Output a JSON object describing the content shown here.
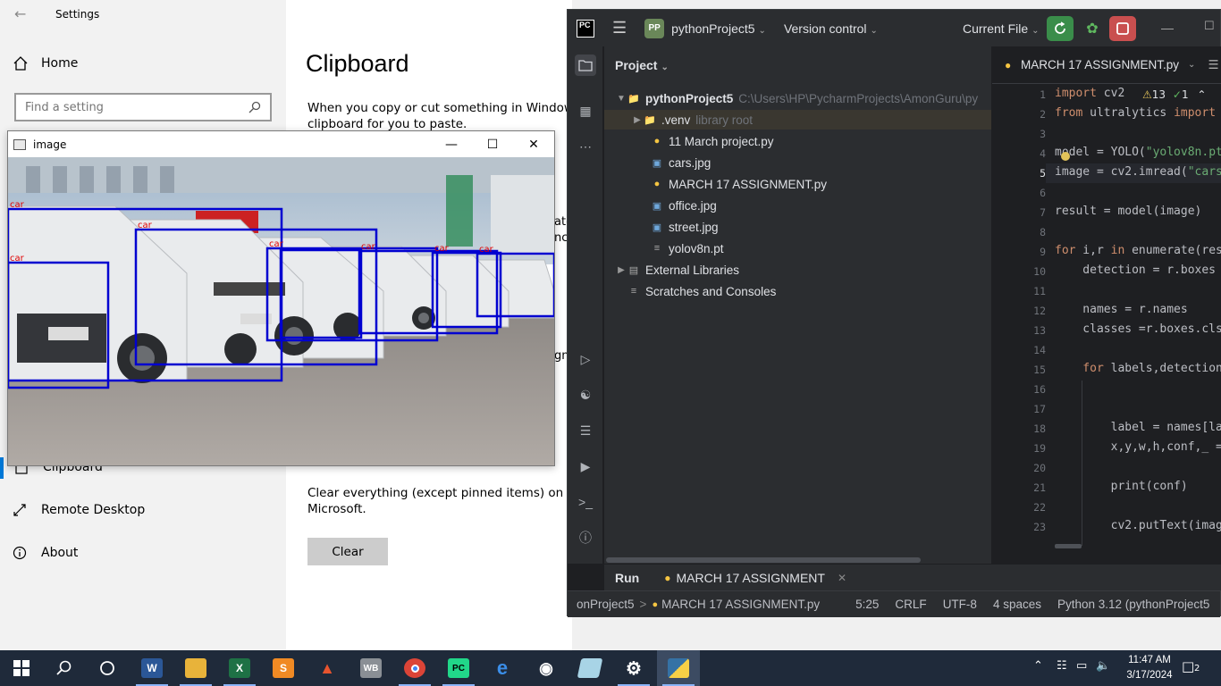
{
  "settings": {
    "title": "Settings",
    "home_label": "Home",
    "search_placeholder": "Find a setting",
    "page_title": "Clipboard",
    "desc_line1": "When you copy or cut something in Windows, i",
    "desc_line2": "clipboard for you to paste.",
    "frag1": "ate",
    "frag2": "nc",
    "frag3": "gn",
    "nav": [
      "Clipboard",
      "Remote Desktop",
      "About"
    ],
    "clear_desc_line1": "Clear everything (except pinned items) on this d",
    "clear_desc_line2": "Microsoft.",
    "clear_button": "Clear"
  },
  "image_window": {
    "title": "image",
    "detections": [
      "car",
      "car",
      "car",
      "car",
      "car",
      "car",
      "car"
    ]
  },
  "pycharm": {
    "project_name": "pythonProject5",
    "vcs": "Version control",
    "run_config": "Current File",
    "panel_title": "Project",
    "tree": {
      "root": "pythonProject5",
      "root_path": "C:\\Users\\HP\\PycharmProjects\\AmonGuru\\py",
      "venv": ".venv",
      "venv_hint": "library root",
      "files": [
        "11 March project.py",
        "cars.jpg",
        "MARCH 17 ASSIGNMENT.py",
        "office.jpg",
        "street.jpg",
        "yolov8n.pt"
      ],
      "external": "External Libraries",
      "scratches": "Scratches and Consoles"
    },
    "editor_tab": "MARCH 17 ASSIGNMENT.py",
    "inspections": {
      "warnings": "13",
      "ok": "1"
    },
    "line_numbers": [
      "1",
      "2",
      "3",
      "4",
      "5",
      "6",
      "7",
      "8",
      "9",
      "10",
      "11",
      "12",
      "13",
      "14",
      "15",
      "16",
      "17",
      "18",
      "19",
      "20",
      "21",
      "22",
      "23"
    ],
    "code": {
      "l1_kw": "import",
      "l1_rest": " cv2",
      "l2_kw": "from",
      "l2_mid": " ultralytics ",
      "l2_kw2": "import",
      "l4_a": "model = YOLO(",
      "l4_s": "\"yolov8n.pt",
      "l5_a": "image = cv2.imread(",
      "l5_s": "\"cars",
      "l7": "result = model(image)",
      "l9_kw": "for",
      "l9_mid": " i,r ",
      "l9_kw2": "in",
      "l9_rest": " enumerate(res",
      "l10": "    detection = r.boxes",
      "l12": "    names = r.names",
      "l13": "    classes =r.boxes.cls",
      "l15_kw": "    for",
      "l15_rest": " labels,detection",
      "l18": "        label = names[la",
      "l19": "        x,y,w,h,conf,_ =",
      "l21": "        print(conf)",
      "l23": "        cv2.putText(imag"
    },
    "run_label": "Run",
    "run_tab": "MARCH 17 ASSIGNMENT",
    "status": {
      "breadcrumb_project": "onProject5",
      "breadcrumb_file": "MARCH 17 ASSIGNMENT.py",
      "position": "5:25",
      "line_sep": "CRLF",
      "encoding": "UTF-8",
      "indent": "4 spaces",
      "interpreter": "Python 3.12 (pythonProject5"
    }
  },
  "taskbar": {
    "time": "11:47 AM",
    "date": "3/17/2024",
    "notifications": "2"
  }
}
